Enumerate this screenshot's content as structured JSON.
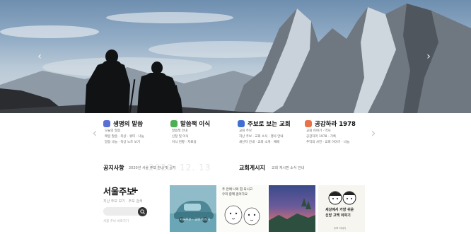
{
  "hero": {
    "prev_icon": "chevron-left-icon",
    "next_icon": "chevron-right-icon"
  },
  "quick_links": [
    {
      "title": "생명의 말씀",
      "icon_color": "#5a6fd6",
      "lines": [
        "오늘의 말씀",
        "매일 말씀 · 묵상 · 큐티 · 나눔",
        "말씀 나눔 · 묵상 노트 보기"
      ]
    },
    {
      "title": "말씀책 이식",
      "icon_color": "#4caf50",
      "lines": [
        "말씀책 안내",
        "신청 및 이식",
        "이식 현황 · 자료실"
      ]
    },
    {
      "title": "주보로 보는 교회",
      "icon_color": "#3f6fd0",
      "lines": [
        "교회 주보",
        "지난 주보 · 교회 소식 · 행사 안내",
        "새신자 안내 · 교회 소개 · 예배"
      ]
    },
    {
      "title": "공감하라 1978",
      "icon_color": "#e8734a",
      "lines": [
        "교회 이야기 · 역사",
        "공감하라 1978 · 기록",
        "추억의 사진 · 교회 이야기 · 나눔"
      ]
    }
  ],
  "notice": {
    "label": "공지사항",
    "text": "2020년 서울 주보 안내 및 공지",
    "ghost": "2020. 12. 13",
    "label2": "교회게시지",
    "text2": "교회 게시판 소식 안내"
  },
  "weekly": {
    "title": "서울주보",
    "plus": "+",
    "description": "지난 주보 보기 · 주보 검색",
    "search_placeholder": "",
    "foot": "서울 주보 바로가기"
  },
  "thumbs": {
    "t1": "서울주보 · 교회 이야기",
    "t2_lines": [
      "주 안에 나의 힘 되시고",
      "우리 함께 걸어가요"
    ],
    "t4_lines": [
      "세상에서 가장 쉬운",
      "신앙 고백 이야기"
    ],
    "t4_foot": "주보 이야기"
  }
}
